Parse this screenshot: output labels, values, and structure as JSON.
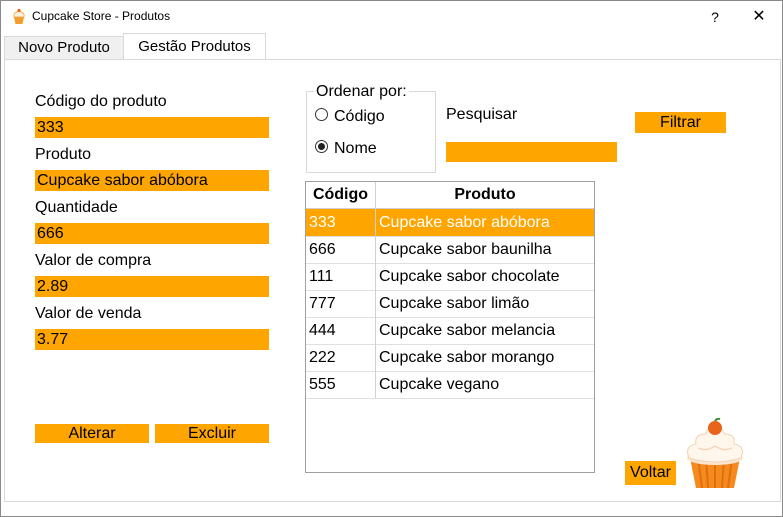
{
  "window": {
    "title": "Cupcake Store - Produtos",
    "help_label": "?",
    "close_label": "✕"
  },
  "tabs": [
    {
      "label": "Novo Produto",
      "active": false
    },
    {
      "label": "Gestão Produtos",
      "active": true
    }
  ],
  "form": {
    "codigo": {
      "label": "Código do produto",
      "value": "333"
    },
    "produto": {
      "label": "Produto",
      "value": "Cupcake sabor abóbora"
    },
    "quantidade": {
      "label": "Quantidade",
      "value": "666"
    },
    "valor_compra": {
      "label": "Valor de compra",
      "value": "2.89"
    },
    "valor_venda": {
      "label": "Valor de venda",
      "value": "3.77"
    }
  },
  "buttons": {
    "alterar": "Alterar",
    "excluir": "Excluir",
    "filtrar": "Filtrar",
    "voltar": "Voltar"
  },
  "order": {
    "legend": "Ordenar por:",
    "options": [
      {
        "label": "Código",
        "checked": false
      },
      {
        "label": "Nome",
        "checked": true
      }
    ]
  },
  "search": {
    "label": "Pesquisar",
    "value": ""
  },
  "table": {
    "headers": [
      "Código",
      "Produto"
    ],
    "rows": [
      {
        "codigo": "333",
        "produto": "Cupcake sabor abóbora",
        "selected": true
      },
      {
        "codigo": "666",
        "produto": "Cupcake sabor baunilha",
        "selected": false
      },
      {
        "codigo": "111",
        "produto": "Cupcake sabor chocolate",
        "selected": false
      },
      {
        "codigo": "777",
        "produto": "Cupcake sabor limão",
        "selected": false
      },
      {
        "codigo": "444",
        "produto": "Cupcake sabor melancia",
        "selected": false
      },
      {
        "codigo": "222",
        "produto": "Cupcake sabor morango",
        "selected": false
      },
      {
        "codigo": "555",
        "produto": "Cupcake vegano",
        "selected": false
      }
    ]
  },
  "colors": {
    "accent": "#ffa500",
    "selected_text": "#ffffff"
  },
  "icons": {
    "app": "cupcake-icon",
    "mascot": "cupcake-illustration"
  }
}
